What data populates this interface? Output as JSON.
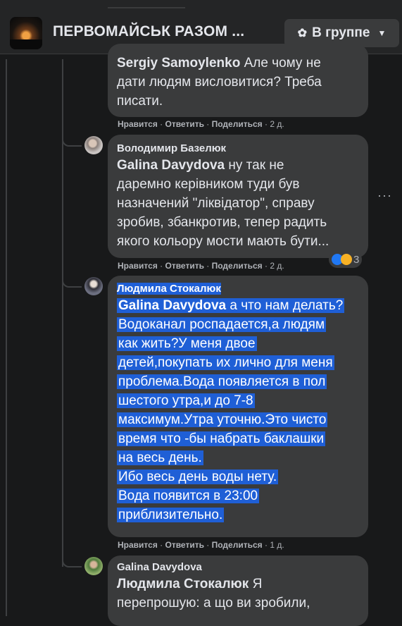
{
  "header": {
    "group_name": "ПЕРВОМАЙСЬК РАЗОМ ...",
    "group_button": "В группе",
    "group_button_icon": "people-icon",
    "dropdown_icon": "caret-down-icon"
  },
  "comments": [
    {
      "author": "",
      "mention": "Sergiy Samoylenko",
      "lines": [
        "Але чому не",
        "дати людям висловитися? Треба",
        "писати."
      ],
      "like_label": "Нравится",
      "reply_label": "Ответить",
      "share_label": "Поделиться",
      "time": "2 д."
    },
    {
      "author": "Володимир Базелюк",
      "mention": "Galina Davydova",
      "lines": [
        "ну так не",
        "даремно керівником туди був",
        "назначений \"ліквідатор\", справу",
        "зробив, збанкротив, тепер радить",
        "якого кольору мости мають бути..."
      ],
      "like_label": "Нравится",
      "reply_label": "Ответить",
      "share_label": "Поделиться",
      "time": "2 д.",
      "reaction_count": "3",
      "reaction_icons": [
        "like-icon",
        "sad-icon"
      ]
    },
    {
      "author": "Людмила Стокалюк",
      "mention": "Galina Davydova",
      "lines": [
        "а что нам делать?",
        "Водоканал роспадается,а людям",
        "как жить?У меня двое",
        "детей,покупать их лично для меня",
        "проблема.Вода появляется в пол",
        "шестого утра,и до 7-8",
        "максимум.Утра уточню.Это чисто",
        "время что -бы набрать баклашки",
        "на весь день.",
        "Ибо весь день воды нету.",
        "Вода появится в 23:00",
        "приблизительно."
      ],
      "like_label": "Нравится",
      "reply_label": "Ответить",
      "share_label": "Поделиться",
      "time": "1 д."
    },
    {
      "author": "Galina Davydova",
      "mention": "Людмила Стокалюк",
      "lines": [
        "Я",
        "перепрошую: а що ви зробили,"
      ]
    }
  ],
  "colors": {
    "background": "#18191a",
    "bubble": "#3a3b3c",
    "selection": "#1f5fd6",
    "secondary_text": "#b0b3b8"
  }
}
